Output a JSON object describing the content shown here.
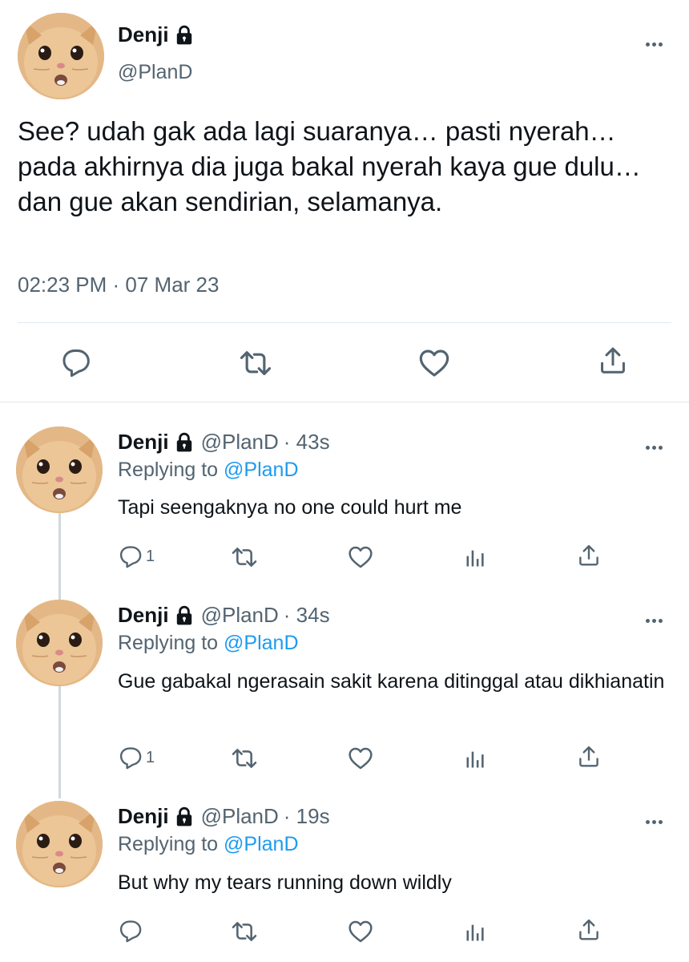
{
  "main_tweet": {
    "name": "Denji",
    "handle": "@PlanD",
    "text": "See? udah gak ada lagi suaranya… pasti nyerah… pada akhirnya dia juga bakal nyerah kaya gue dulu… dan gue akan sendirian, selamanya.",
    "timestamp": "02:23 PM · 07 Mar 23"
  },
  "replies": [
    {
      "name": "Denji",
      "handle": "@PlanD",
      "time": "· 43s",
      "replying_label": "Replying to",
      "replying_to": "@PlanD",
      "text": "Tapi seengaknya no one could hurt me",
      "reply_count": "1"
    },
    {
      "name": "Denji",
      "handle": "@PlanD",
      "time": "· 34s",
      "replying_label": "Replying to",
      "replying_to": "@PlanD",
      "text": "Gue gabakal ngerasain sakit karena ditinggal atau dikhianatin",
      "reply_count": "1"
    },
    {
      "name": "Denji",
      "handle": "@PlanD",
      "time": "· 19s",
      "replying_label": "Replying to",
      "replying_to": "@PlanD",
      "text": "But why my tears running down wildly",
      "reply_count": ""
    }
  ],
  "colors": {
    "text": "#0f1419",
    "secondary": "#536471",
    "link": "#1d9bf0",
    "divider": "#e1e8ed"
  },
  "icons": {
    "lock": "lock-icon",
    "more": "more-icon",
    "reply": "reply-icon",
    "retweet": "retweet-icon",
    "like": "like-icon",
    "views": "views-icon",
    "share": "share-icon",
    "avatar": "cat-avatar"
  }
}
